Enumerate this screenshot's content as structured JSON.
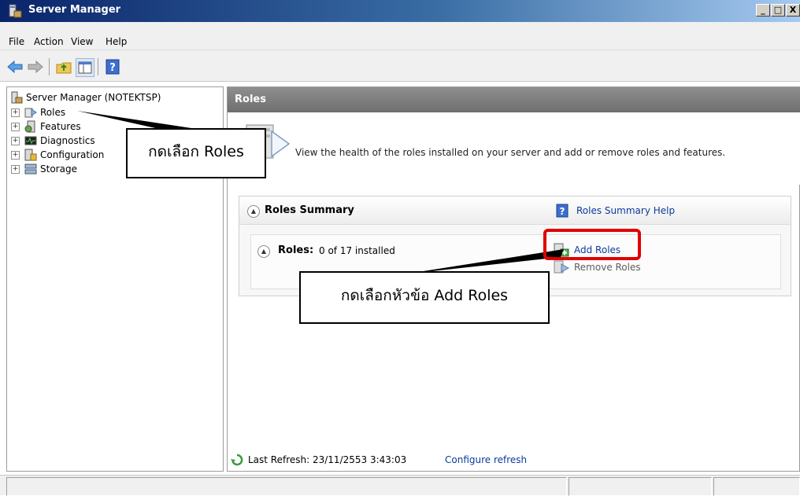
{
  "window": {
    "title": "Server Manager",
    "min_glyph": "_",
    "max_glyph": "□",
    "close_glyph": "X"
  },
  "menubar": {
    "items": [
      {
        "label": "File"
      },
      {
        "label": "Action"
      },
      {
        "label": "View"
      },
      {
        "label": "Help"
      }
    ]
  },
  "toolbar": {
    "icons": [
      "back-arrow-icon",
      "forward-arrow-icon",
      "up-folder-icon",
      "show-hide-console-tree-icon",
      "help-icon"
    ]
  },
  "tree": {
    "root": "Server Manager (NOTEKTSP)",
    "items": [
      {
        "label": "Roles",
        "expander": "+"
      },
      {
        "label": "Features",
        "expander": "+"
      },
      {
        "label": "Diagnostics",
        "expander": "+"
      },
      {
        "label": "Configuration",
        "expander": "+"
      },
      {
        "label": "Storage",
        "expander": "+"
      }
    ]
  },
  "right_pane": {
    "header": "Roles",
    "intro": "View the health of the roles installed on your server and add or remove roles and features.",
    "summary": {
      "title": "Roles Summary",
      "help_link": "Roles Summary Help",
      "roles_label": "Roles:",
      "roles_value": "0 of 17 installed",
      "add_roles": "Add Roles",
      "remove_roles": "Remove Roles"
    },
    "last_refresh": "Last Refresh: 23/11/2553 3:43:03",
    "configure_refresh": "Configure refresh"
  },
  "annotations": {
    "select_roles": "กดเลือก Roles",
    "select_add_roles": "กดเลือกหัวข้อ Add Roles"
  },
  "colors": {
    "highlight": "#e00000",
    "link": "#0b3a9b",
    "header_bg": "#7f7f7f"
  }
}
